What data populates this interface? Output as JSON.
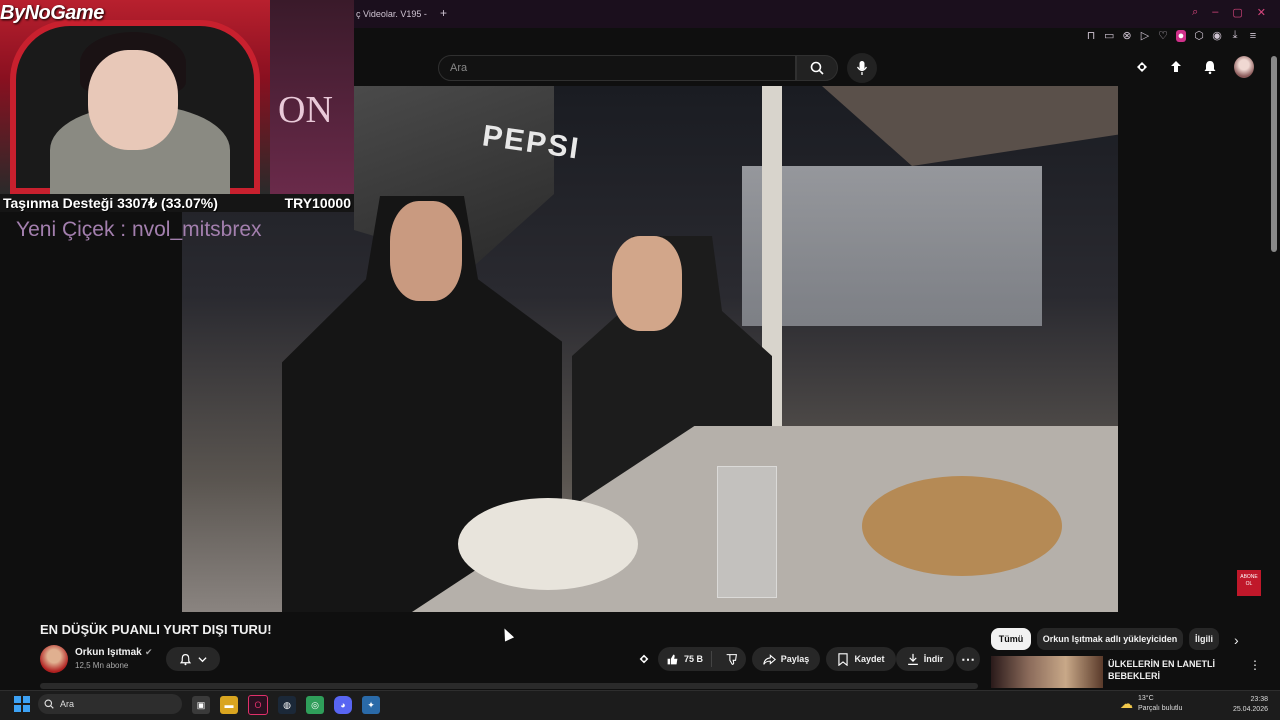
{
  "browser": {
    "tab_title": "ç Videolar. V195 - ",
    "new_tab_icon": "+"
  },
  "youtube_header": {
    "search_placeholder": "Ara"
  },
  "overlay": {
    "logo_text": "ByNoGame",
    "side_text": "ON",
    "donation_left": "Taşınma Desteği 3307₺ (33.07%)",
    "donation_right": "TRY10000",
    "alert_text": "Yeni Çiçek : nvol_mitsbrex"
  },
  "video": {
    "sign_text": "PEPSI",
    "subscribe_badge": "ABONE OL"
  },
  "video_info": {
    "title": "EN DÜŞÜK PUANLI YURT DIŞI TURU!",
    "channel_name": "Orkun Işıtmak",
    "subscriber_count": "12,5 Mn abone",
    "like_count": "75 B",
    "share_label": "Paylaş",
    "save_label": "Kaydet",
    "download_label": "İndir"
  },
  "sidebar": {
    "chips": [
      "Tümü",
      "Orkun Işıtmak adlı yükleyiciden",
      "İlgili"
    ],
    "recommendation_title": "ÜLKELERİN EN LANETLİ BEBEKLERİ"
  },
  "taskbar": {
    "search_placeholder": "Ara",
    "temperature": "13°C",
    "weather_desc": "Parçalı bulutlu",
    "time": "23:38",
    "date": "25.04.2026"
  },
  "colors": {
    "accent_red": "#c8202e",
    "alert_purple": "#a37fae",
    "background": "#0f0f0f"
  }
}
